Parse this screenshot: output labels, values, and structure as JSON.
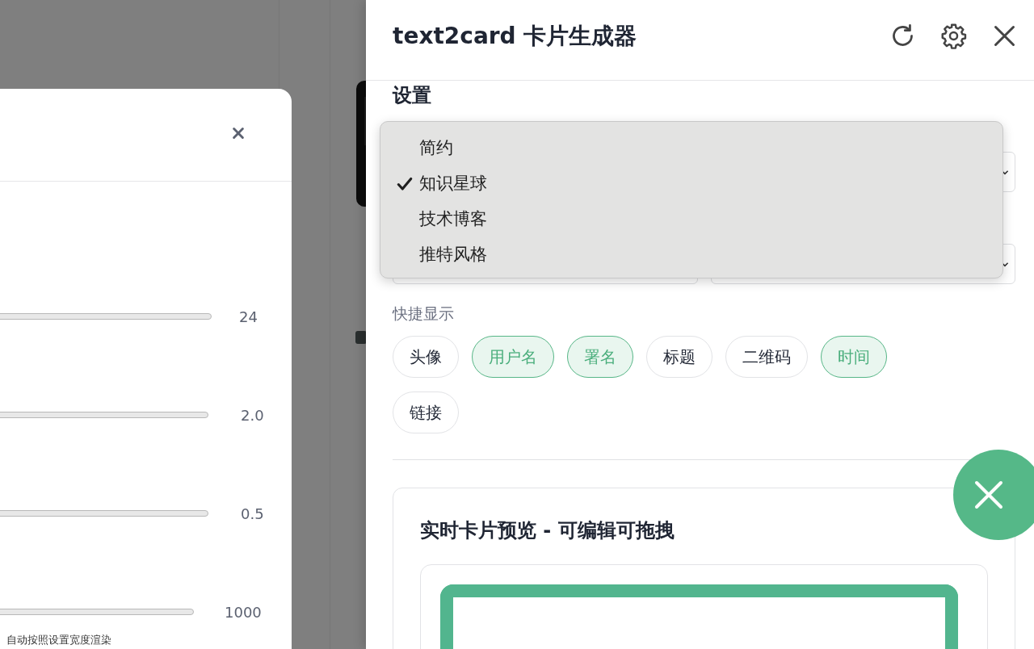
{
  "settings_modal": {
    "slider_values": [
      "24",
      "2.0",
      "0.5",
      "1000"
    ],
    "note": "自动按照设置宽度渲染"
  },
  "panel": {
    "title": "text2card 卡片生成器",
    "section_title": "设置",
    "style_dropdown": {
      "options": [
        {
          "label": "简约",
          "selected": false
        },
        {
          "label": "知识星球",
          "selected": true
        },
        {
          "label": "技术博客",
          "selected": false
        },
        {
          "label": "推特风格",
          "selected": false
        }
      ]
    },
    "quick_display": {
      "label": "快捷显示",
      "chips": [
        {
          "label": "头像",
          "selected": false
        },
        {
          "label": "用户名",
          "selected": true
        },
        {
          "label": "署名",
          "selected": true
        },
        {
          "label": "标题",
          "selected": false
        },
        {
          "label": "二维码",
          "selected": false
        },
        {
          "label": "时间",
          "selected": true
        },
        {
          "label": "链接",
          "selected": false
        }
      ]
    },
    "preview": {
      "title": "实时卡片预览 - 可编辑可拖拽"
    }
  }
}
